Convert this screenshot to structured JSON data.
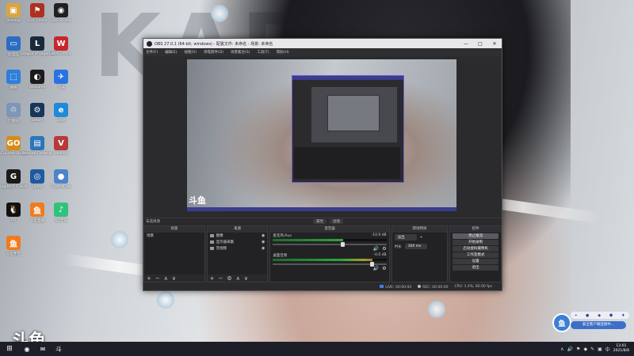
{
  "desktop": {
    "wallpaper_text": "KAREN",
    "icons": [
      {
        "label": "Desktop",
        "color": "#d9a441",
        "glyph": "▣"
      },
      {
        "label": "FIFA Online",
        "color": "#b03020",
        "glyph": "⚑"
      },
      {
        "label": "OBS Studio",
        "color": "#202020",
        "glyph": "◉"
      },
      {
        "label": "此电脑",
        "color": "#2b6cc4",
        "glyph": "▭"
      },
      {
        "label": "League of Legends",
        "color": "#1a2a3c",
        "glyph": "L"
      },
      {
        "label": "WPS Office",
        "color": "#c8262b",
        "glyph": "W"
      },
      {
        "label": "网络",
        "color": "#2f7ed8",
        "glyph": "⬚"
      },
      {
        "label": "WeGame",
        "color": "#1b1b1b",
        "glyph": "◐"
      },
      {
        "label": "飞书",
        "color": "#2a72e0",
        "glyph": "✈"
      },
      {
        "label": "回收站",
        "color": "#7d96b6",
        "glyph": "♲"
      },
      {
        "label": "Steam",
        "color": "#17365a",
        "glyph": "⚙"
      },
      {
        "label": "Edge",
        "color": "#1f8ad9",
        "glyph": "e"
      },
      {
        "label": "Counter-Strike",
        "color": "#d68c1a",
        "glyph": "GO"
      },
      {
        "label": "Remote Desktop",
        "color": "#2c75b8",
        "glyph": "▤"
      },
      {
        "label": "Valorant",
        "color": "#b83939",
        "glyph": "V"
      },
      {
        "label": "Logitech G HUB",
        "color": "#1a1a1a",
        "glyph": "G"
      },
      {
        "label": "Uplay",
        "color": "#1e5aa0",
        "glyph": "◎"
      },
      {
        "label": "CrystalDisk",
        "color": "#4d84c9",
        "glyph": "●"
      },
      {
        "label": "QQ",
        "color": "#111",
        "glyph": "🐧"
      },
      {
        "label": "斗鱼直播",
        "color": "#f07b1f",
        "glyph": "鱼"
      },
      {
        "label": "QQ音乐",
        "color": "#31c27c",
        "glyph": "♪"
      },
      {
        "label": "斗鱼伴侣",
        "color": "#f07b1f",
        "glyph": "鱼"
      }
    ],
    "watermark": "斗鱼"
  },
  "obs": {
    "title": "OBS 27.0.1 (64-bit, windows) - 配置文件: 未命名 - 场景: 未命名",
    "window_controls": [
      "—",
      "□",
      "✕"
    ],
    "menu": [
      "文件(F)",
      "编辑(E)",
      "视图(V)",
      "停靠部件(D)",
      "场景集合(S)",
      "工具(T)",
      "帮助(H)"
    ],
    "preview_logo": "斗鱼",
    "status_line": {
      "label": "未选择源",
      "properties_btn": "属性",
      "filters_btn": "滤镜"
    },
    "scenes": {
      "header": "场景",
      "items": [
        "场景"
      ]
    },
    "sources": {
      "header": "来源",
      "items": [
        {
          "name": "图像"
        },
        {
          "name": "显示器采集"
        },
        {
          "name": "音视频"
        }
      ]
    },
    "mixer": {
      "header": "混音器",
      "channels": [
        {
          "name": "麦克风/Aux",
          "db": "-10.9 dB",
          "level": 0.62
        },
        {
          "name": "桌面音频",
          "db": "-0.0 dB",
          "level": 0.88
        }
      ]
    },
    "transitions": {
      "header": "转场特效",
      "type_label": "淡出",
      "duration_label": "时长",
      "duration_value": "300 ms"
    },
    "controls": {
      "header": "控件",
      "buttons": [
        "停止推流",
        "开始录制",
        "启动虚拟摄像机",
        "工作室模式",
        "设置",
        "退出"
      ]
    },
    "statusbar": {
      "live_label": "LIVE:",
      "live_time": "00:00:00",
      "rec_label": "REC:",
      "rec_time": "00:00:00",
      "cpu": "CPU: 1.4%, 60.00 fps"
    }
  },
  "notification": {
    "top_icons": [
      "⌖",
      "●",
      "◆",
      "⬢",
      "♦"
    ],
    "badge": "鱼",
    "message": "安全客户端连接中..."
  },
  "taskbar": {
    "start_glyph": "⊞",
    "apps": [
      "◉",
      "✉",
      "斗"
    ],
    "tray_icons": [
      "∧",
      "🔊",
      "⚑",
      "◆",
      "✎",
      "▣",
      "中"
    ],
    "time": "13:01",
    "date": "2021/8/8"
  }
}
